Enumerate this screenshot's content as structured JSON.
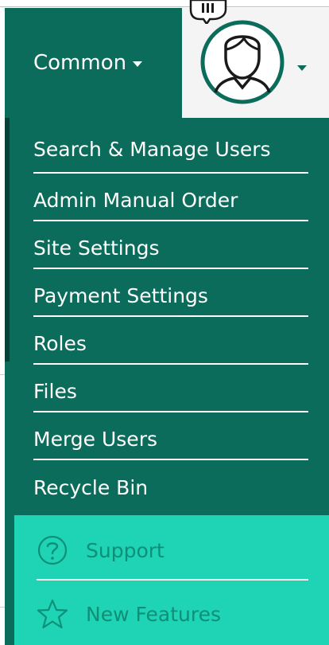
{
  "nav": {
    "common_label": "Common"
  },
  "menu": {
    "items": [
      {
        "label": "Search & Manage Users"
      },
      {
        "label": "Admin Manual Order"
      },
      {
        "label": "Site Settings"
      },
      {
        "label": "Payment Settings"
      },
      {
        "label": "Roles"
      },
      {
        "label": "Files"
      },
      {
        "label": "Merge Users"
      },
      {
        "label": "Recycle Bin"
      }
    ]
  },
  "footer": {
    "support_label": "Support",
    "new_features_label": "New Features",
    "support_icon": "question-circle-icon",
    "new_features_icon": "star-icon"
  },
  "colors": {
    "primary": "#0b6c5b",
    "footer_bg": "#1fd3b5",
    "footer_text": "#0e8f77",
    "user_area_bg": "#f4f4f4"
  }
}
